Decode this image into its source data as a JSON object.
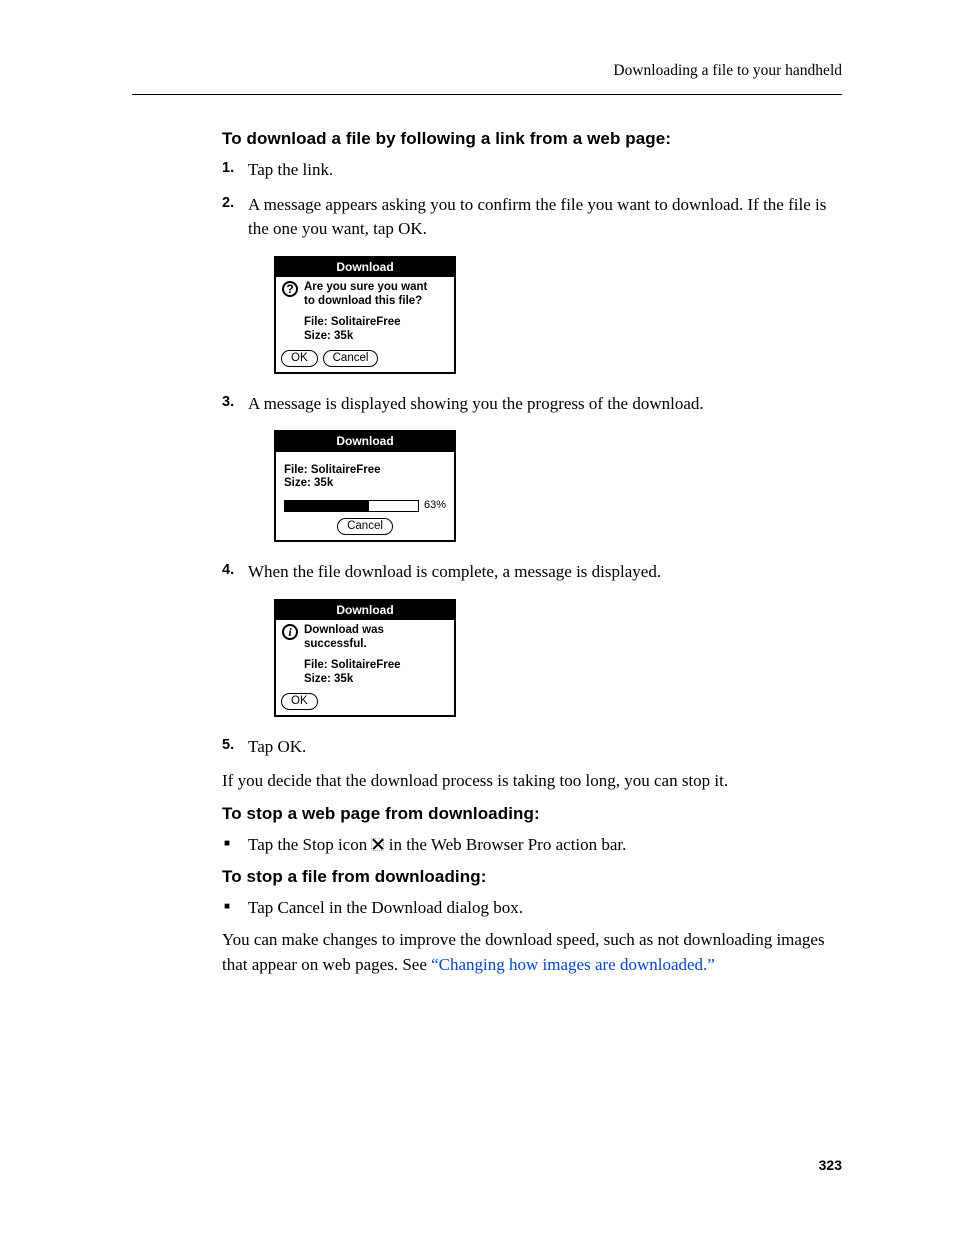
{
  "header": {
    "running_head": "Downloading a file to your handheld"
  },
  "section1": {
    "heading": "To download a file by following a link from a web page:",
    "step1": "Tap the link.",
    "step2": "A message appears asking you to confirm the file you want to download. If the file is the one you want, tap OK.",
    "step3": "A message is displayed showing you the progress of the download.",
    "step4": "When the file download is complete, a message is displayed.",
    "step5": "Tap OK.",
    "post": "If you decide that the download process is taking too long, you can stop it."
  },
  "dialog_confirm": {
    "title": "Download",
    "msg_l1": "Are you sure you want",
    "msg_l2": "to download this file?",
    "file_label": "File: SolitaireFree",
    "size_label": "Size: 35k",
    "ok": "OK",
    "cancel": "Cancel"
  },
  "dialog_progress": {
    "title": "Download",
    "file_label": "File: SolitaireFree",
    "size_label": "Size: 35k",
    "pct": "63%",
    "cancel": "Cancel"
  },
  "dialog_done": {
    "title": "Download",
    "msg_l1": "Download was",
    "msg_l2": "successful.",
    "file_label": "File: SolitaireFree",
    "size_label": "Size: 35k",
    "ok": "OK"
  },
  "section2": {
    "heading": "To stop a web page from downloading:",
    "bullet_pre": "Tap the Stop icon ",
    "bullet_post": " in the Web Browser Pro action bar."
  },
  "section3": {
    "heading": "To stop a file from downloading:",
    "bullet": "Tap Cancel in the Download dialog box.",
    "para_pre": "You can make changes to improve the download speed, such as not downloading images that appear on web pages. See ",
    "link": "“Changing how images are downloaded.”"
  },
  "page_number": "323"
}
